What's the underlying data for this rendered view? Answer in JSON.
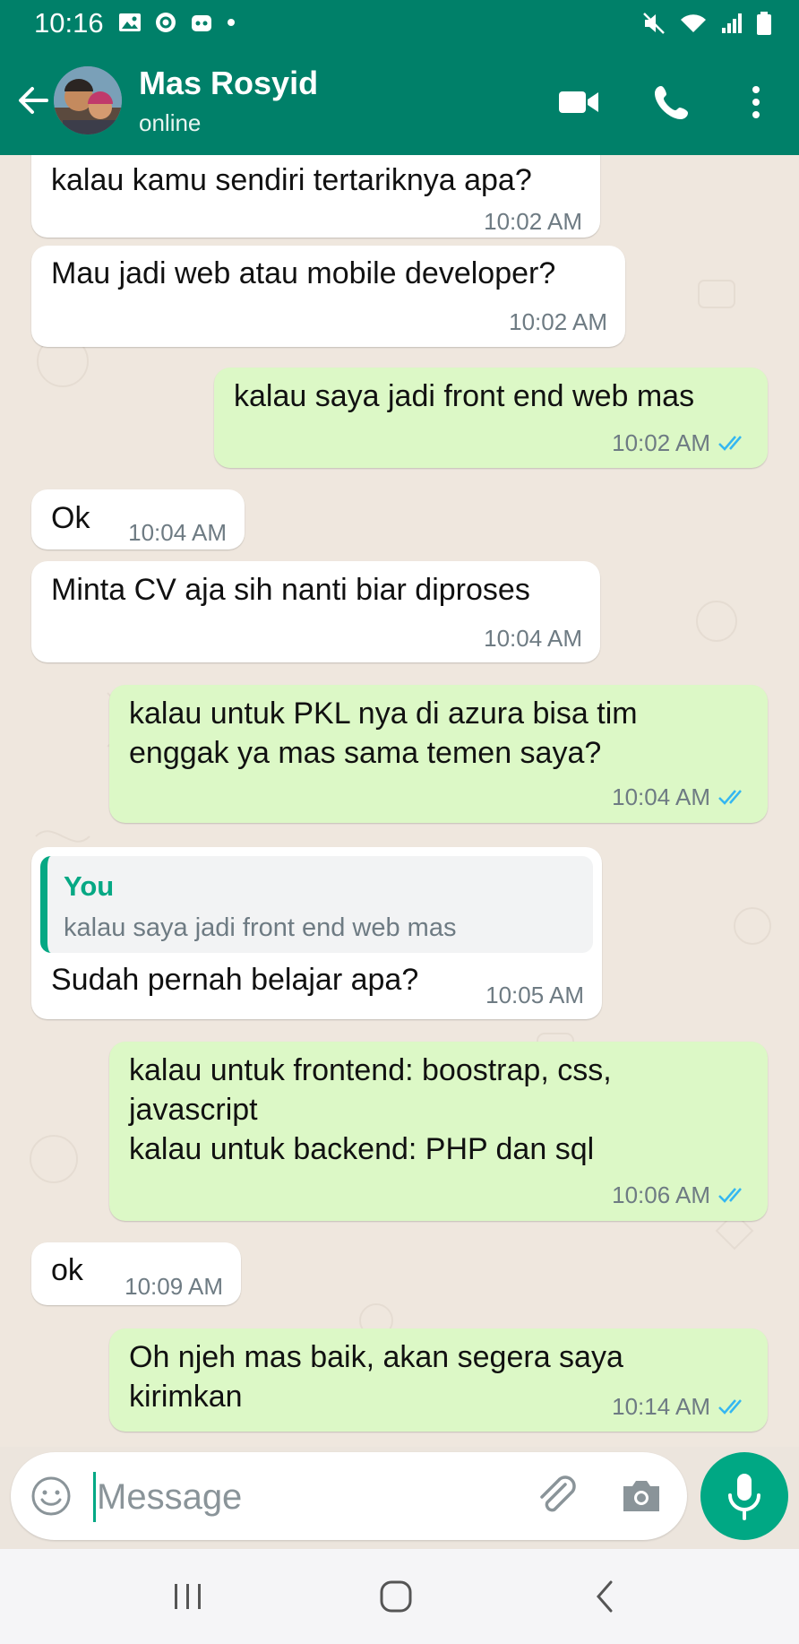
{
  "status_bar": {
    "time": "10:16"
  },
  "header": {
    "contact_name": "Mas Rosyid",
    "contact_status": "online"
  },
  "messages": [
    {
      "dir": "in",
      "text": "kalau kamu sendiri tertariknya apa?",
      "time": "10:02 AM"
    },
    {
      "dir": "in",
      "text": "Mau jadi web atau mobile developer?",
      "time": "10:02 AM"
    },
    {
      "dir": "out",
      "text": "kalau saya jadi front end web mas",
      "time": "10:02 AM",
      "status": "read"
    },
    {
      "dir": "in",
      "text": "Ok",
      "time": "10:04 AM"
    },
    {
      "dir": "in",
      "text": "Minta CV aja sih nanti biar diproses",
      "time": "10:04 AM"
    },
    {
      "dir": "out",
      "text": "kalau untuk PKL nya di azura bisa tim\nenggak ya mas sama temen saya?",
      "time": "10:04 AM",
      "status": "read"
    },
    {
      "dir": "in",
      "reply_to": {
        "author": "You",
        "text": "kalau saya jadi front end web mas"
      },
      "text": "Sudah pernah belajar apa?",
      "time": "10:05 AM"
    },
    {
      "dir": "out",
      "text": "kalau untuk frontend: boostrap, css,\njavascript\nkalau untuk backend: PHP dan sql",
      "time": "10:06 AM",
      "status": "read"
    },
    {
      "dir": "in",
      "text": "ok",
      "time": "10:09 AM"
    },
    {
      "dir": "out",
      "text": "Oh njeh mas baik, akan segera saya\nkirimkan",
      "time": "10:14 AM",
      "status": "read"
    }
  ],
  "composer": {
    "placeholder": "Message"
  },
  "icons": {
    "back": "arrow-left-icon",
    "video": "video-camera-icon",
    "call": "phone-icon",
    "menu": "more-vertical-icon",
    "emoji": "emoji-icon",
    "attach": "paperclip-icon",
    "camera": "camera-icon",
    "mic": "microphone-icon"
  },
  "colors": {
    "header": "#008069",
    "outgoing_bubble": "#dcf8c6",
    "incoming_bubble": "#ffffff",
    "accent": "#00a884",
    "read_tick": "#34b7f1"
  }
}
